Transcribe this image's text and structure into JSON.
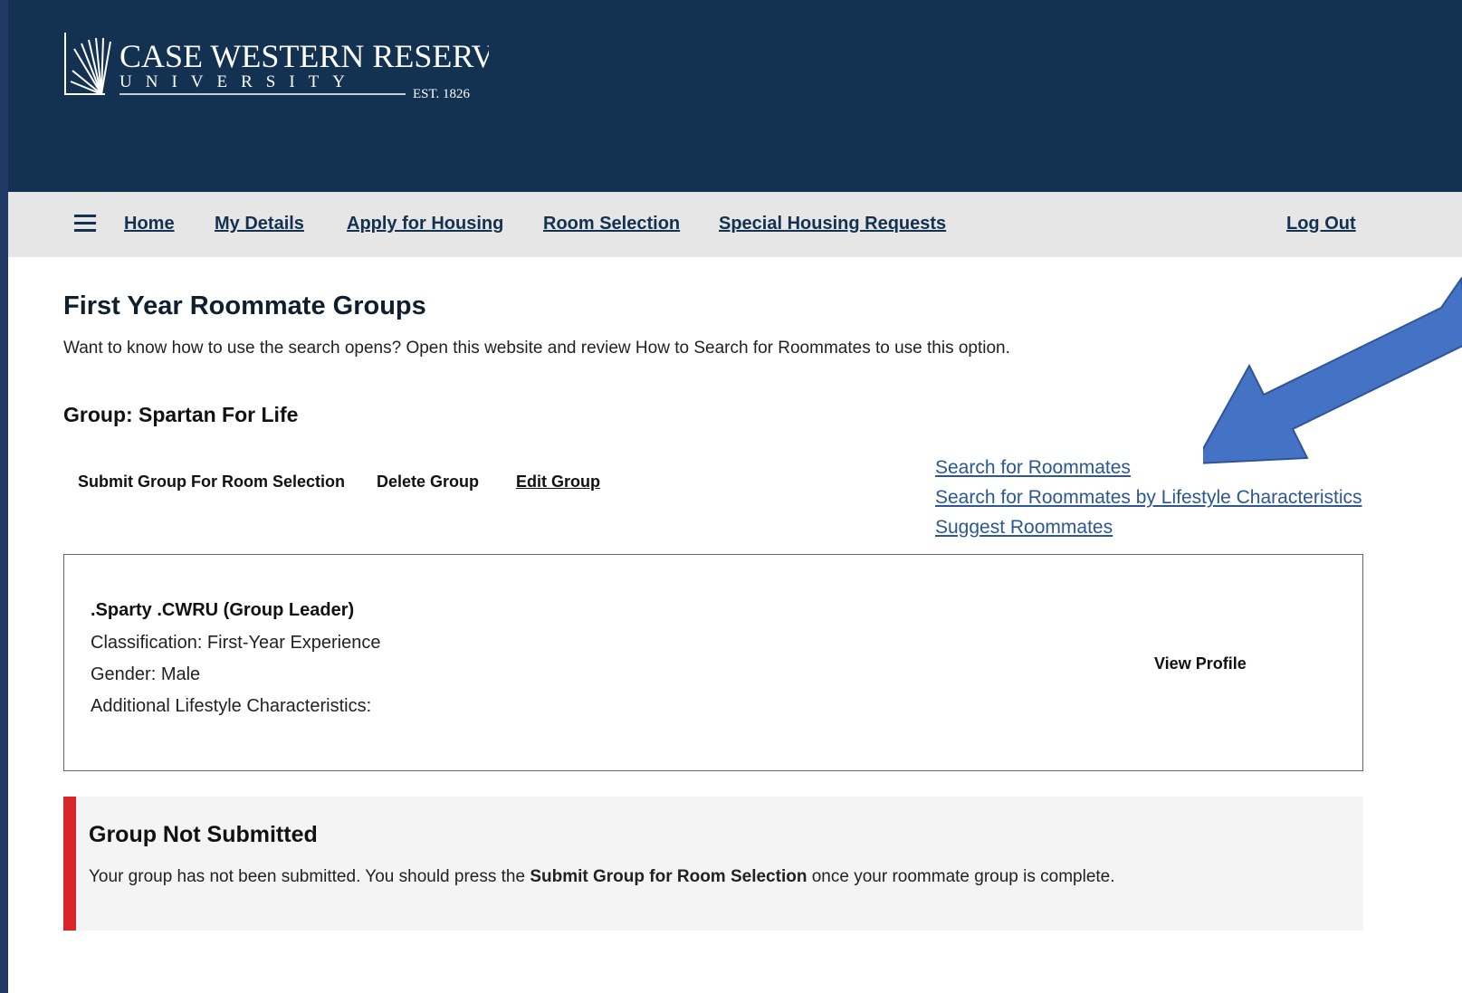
{
  "logo": {
    "name": "CASE WESTERN RESERVE",
    "sub": "UNIVERSITY",
    "est": "EST. 1826"
  },
  "nav": {
    "menu_icon": "hamburger-menu-icon",
    "home": "Home",
    "my_details": "My Details",
    "apply_housing": "Apply for Housing",
    "room_selection": "Room Selection",
    "special_requests": "Special Housing Requests",
    "log_out": "Log Out"
  },
  "page": {
    "title": "First Year Roommate Groups",
    "intro": "Want to know how to use the search opens? Open this website and review How to Search for Roommates to use this option."
  },
  "group": {
    "name": "Group: Spartan For Life",
    "actions": {
      "submit": "Submit Group For Room Selection",
      "delete": "Delete Group",
      "edit": "Edit Group"
    },
    "search_links": {
      "search": "Search for Roommates",
      "lifestyle": "Search for Roommates by Lifestyle Characteristics",
      "suggest": "Suggest Roommates"
    }
  },
  "member": {
    "name": ".Sparty .CWRU (Group Leader)",
    "classification": "Classification: First-Year Experience",
    "gender": "Gender: Male",
    "lifestyle": "Additional Lifestyle Characteristics:",
    "view_profile": "View Profile"
  },
  "notice": {
    "title": "Group Not Submitted",
    "text_before": "Your group has not been submitted. You should press the ",
    "text_bold": "Submit Group for Room Selection",
    "text_after": " once your roommate group is complete."
  },
  "colors": {
    "header_bg": "#133151",
    "nav_bg": "#e6e6e6",
    "link": "#2b5797",
    "notice_bar": "#d9262b",
    "arrow": "#4472c4"
  }
}
